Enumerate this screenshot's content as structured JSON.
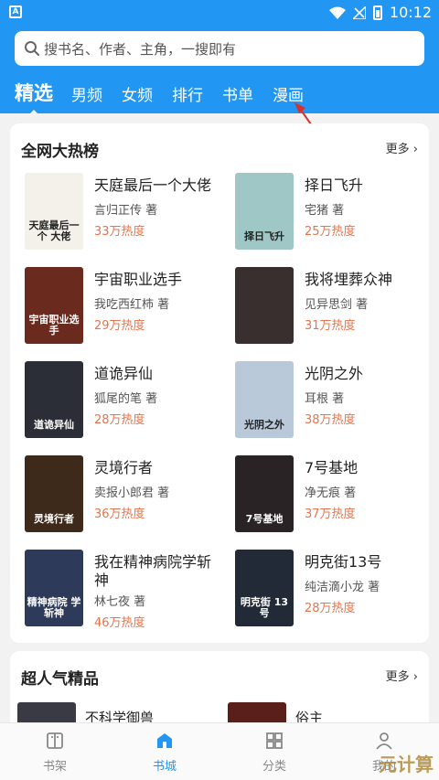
{
  "status_bar": {
    "app_badge": "A",
    "time": "10:12"
  },
  "search": {
    "placeholder": "搜书名、作者、主角，一搜即有"
  },
  "tabs": [
    {
      "label": "精选",
      "active": true
    },
    {
      "label": "男频"
    },
    {
      "label": "女频"
    },
    {
      "label": "排行"
    },
    {
      "label": "书单"
    },
    {
      "label": "漫画"
    }
  ],
  "section_hot": {
    "title": "全网大热榜",
    "more": "更多",
    "books": [
      {
        "title": "天庭最后一个大佬",
        "author": "言归正传 著",
        "heat": "33万热度",
        "cover_text": "天庭最后一个 大佬",
        "cover_color": "#f4f1ea"
      },
      {
        "title": "择日飞升",
        "author": "宅猪 著",
        "heat": "25万热度",
        "cover_text": "择日飞升",
        "cover_color": "#9fc7c6"
      },
      {
        "title": "宇宙职业选手",
        "author": "我吃西红柿 著",
        "heat": "29万热度",
        "cover_text": "宇宙职业选手",
        "cover_color": "#6a2a1e"
      },
      {
        "title": "我将埋葬众神",
        "author": "见异思剑 著",
        "heat": "31万热度",
        "cover_text": "",
        "cover_color": "#3a2f2f"
      },
      {
        "title": "道诡异仙",
        "author": "狐尾的笔 著",
        "heat": "28万热度",
        "cover_text": "道诡异仙",
        "cover_color": "#2b2e36"
      },
      {
        "title": "光阴之外",
        "author": "耳根 著",
        "heat": "38万热度",
        "cover_text": "光阴之外",
        "cover_color": "#b9c9d9"
      },
      {
        "title": "灵境行者",
        "author": "卖报小郎君 著",
        "heat": "36万热度",
        "cover_text": "灵境行者",
        "cover_color": "#3d2a1a"
      },
      {
        "title": "7号基地",
        "author": "净无痕 著",
        "heat": "37万热度",
        "cover_text": "7号基地",
        "cover_color": "#2a2326"
      },
      {
        "title": "我在精神病院学斩神",
        "author": "林七夜 著",
        "heat": "46万热度",
        "cover_text": "精神病院 学斩神",
        "cover_color": "#2e3a5a"
      },
      {
        "title": "明克街13号",
        "author": "纯洁滴小龙 著",
        "heat": "28万热度",
        "cover_text": "明克街 13号",
        "cover_color": "#222a38"
      }
    ]
  },
  "section_popular": {
    "title": "超人气精品",
    "more": "更多",
    "books": [
      {
        "title": "不科学御兽",
        "cover_color": "#3a3a44"
      },
      {
        "title": "俗主",
        "cover_color": "#5a1f1a"
      }
    ]
  },
  "bottom_nav": [
    {
      "label": "书架",
      "icon": "bookshelf-icon"
    },
    {
      "label": "书城",
      "icon": "store-icon",
      "active": true
    },
    {
      "label": "分类",
      "icon": "category-icon"
    },
    {
      "label": "我的",
      "icon": "profile-icon"
    }
  ],
  "watermark": "元计算",
  "colors": {
    "primary": "#2196f3",
    "heat": "#e8734a",
    "background": "#f2f2f2"
  }
}
